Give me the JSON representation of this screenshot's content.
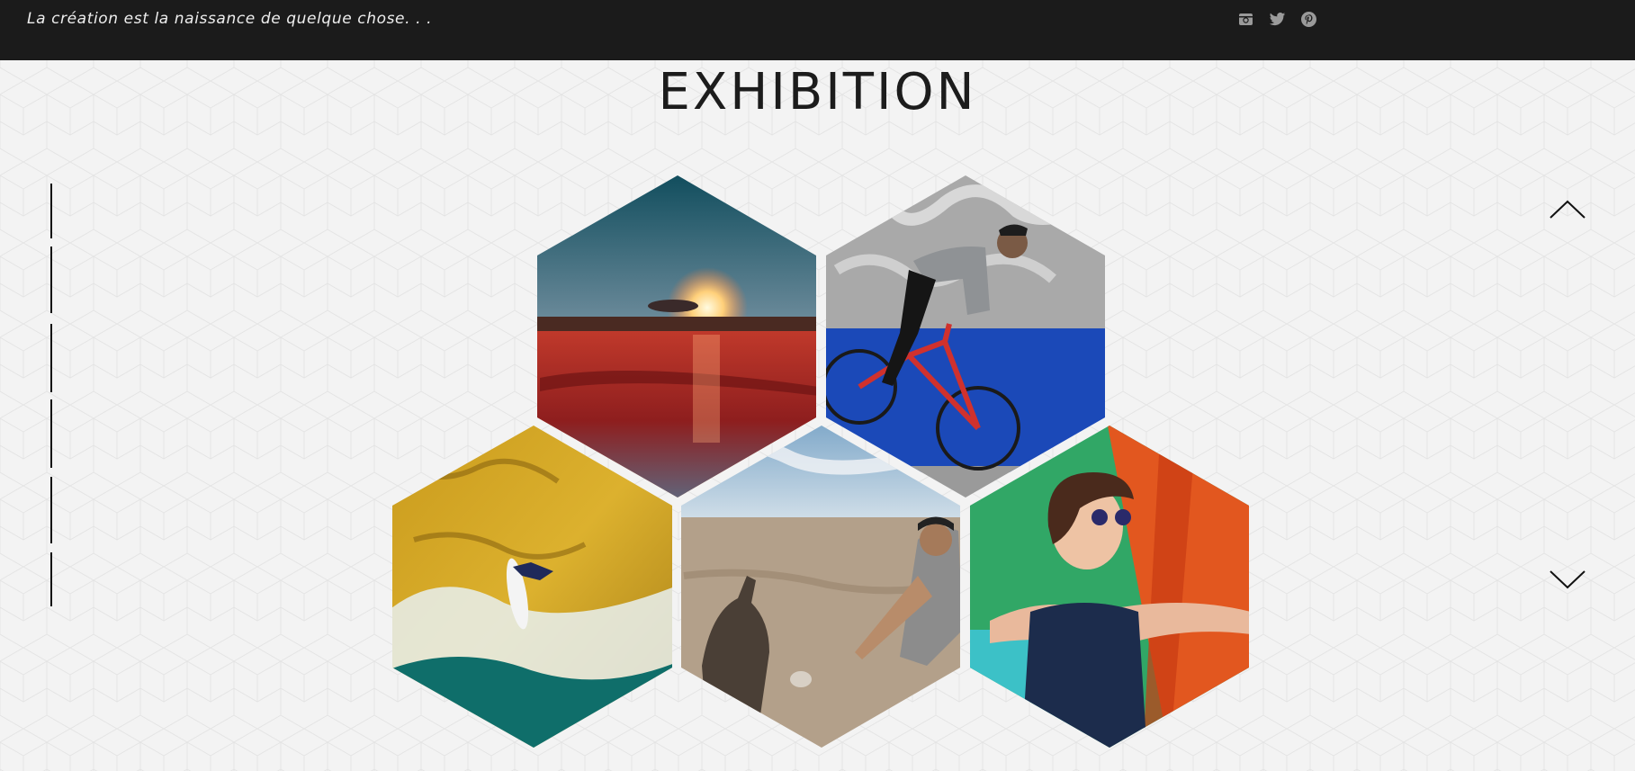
{
  "header": {
    "tagline": "La création est la naissance de quelque chose. . .",
    "background_color": "#1b1b1b",
    "social_icons": [
      "instagram-icon",
      "twitter-icon",
      "pinterest-icon"
    ]
  },
  "page": {
    "title": "EXHIBITION",
    "background_color": "#f3f3f3"
  },
  "gallery": {
    "tiles": [
      {
        "name": "gallery-tile-sunset",
        "subject": "sunset over tidal flats"
      },
      {
        "name": "gallery-tile-cyclist",
        "subject": "bmx rider in front of graffiti wall"
      },
      {
        "name": "gallery-tile-surfer",
        "subject": "surfer by yellow cliff"
      },
      {
        "name": "gallery-tile-donkey",
        "subject": "man reaching to donkey in desert"
      },
      {
        "name": "gallery-tile-woman",
        "subject": "smiling woman with sunglasses by colorful wall"
      }
    ]
  },
  "navigation": {
    "section_count": 6,
    "scroll_up_icon": "chevron-up-icon",
    "scroll_down_icon": "chevron-down-icon"
  }
}
